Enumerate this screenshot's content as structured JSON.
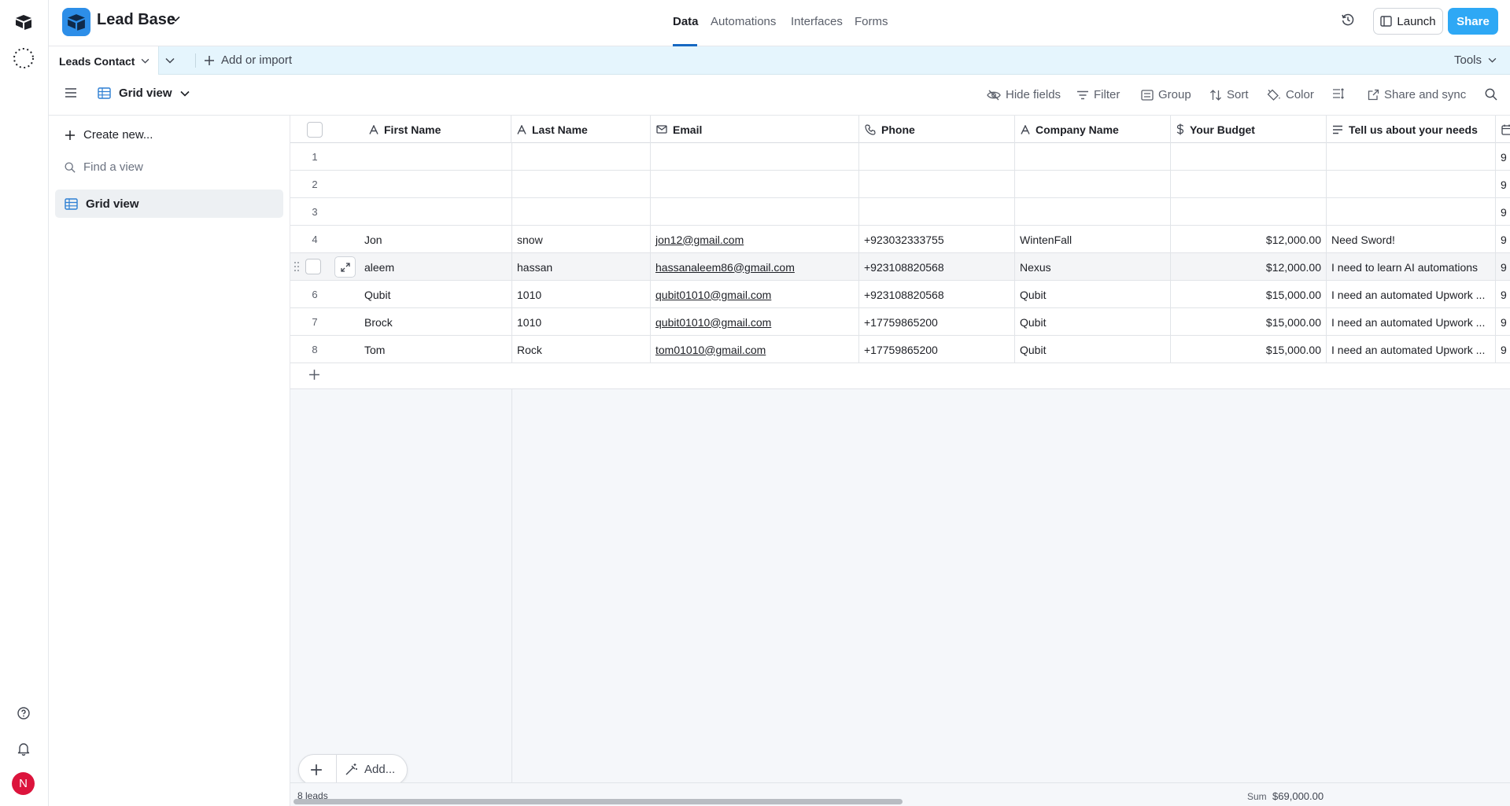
{
  "app": {
    "base_name": "Lead Base",
    "nav_tabs": [
      "Data",
      "Automations",
      "Interfaces",
      "Forms"
    ],
    "active_tab": "Data",
    "launch_label": "Launch",
    "share_label": "Share",
    "avatar_initial": "N",
    "accent_color": "#2ea8f5"
  },
  "tablebar": {
    "table_name": "Leads Contact",
    "add_import_label": "Add or import",
    "tools_label": "Tools"
  },
  "viewbar": {
    "view_name": "Grid view",
    "tools": [
      "Hide fields",
      "Filter",
      "Group",
      "Sort",
      "Color",
      "Share and sync"
    ]
  },
  "sidebar": {
    "create_new_label": "Create new...",
    "find_view_placeholder": "Find a view",
    "views": [
      "Grid view"
    ]
  },
  "grid": {
    "columns": [
      {
        "name": "First Name",
        "icon": "text-icon"
      },
      {
        "name": "Last Name",
        "icon": "text-icon"
      },
      {
        "name": "Email",
        "icon": "email-icon"
      },
      {
        "name": "Phone",
        "icon": "phone-icon"
      },
      {
        "name": "Company Name",
        "icon": "text-icon"
      },
      {
        "name": "Your Budget",
        "icon": "currency-icon"
      },
      {
        "name": "Tell us about your needs",
        "icon": "long-text-icon"
      }
    ],
    "rows": [
      {
        "num": "1",
        "first": "",
        "last": "",
        "email": "",
        "phone": "",
        "company": "",
        "budget": "",
        "needs": "",
        "extra": "9"
      },
      {
        "num": "2",
        "first": "",
        "last": "",
        "email": "",
        "phone": "",
        "company": "",
        "budget": "",
        "needs": "",
        "extra": "9"
      },
      {
        "num": "3",
        "first": "",
        "last": "",
        "email": "",
        "phone": "",
        "company": "",
        "budget": "",
        "needs": "",
        "extra": "9"
      },
      {
        "num": "4",
        "first": "Jon",
        "last": "snow",
        "email": "jon12@gmail.com",
        "phone": "+923032333755",
        "company": "WintenFall",
        "budget": "$12,000.00",
        "needs": "Need Sword!",
        "extra": "9"
      },
      {
        "num": "5",
        "first": "aleem",
        "last": "hassan",
        "email": "hassanaleem86@gmail.com",
        "phone": "+923108820568",
        "company": "Nexus",
        "budget": "$12,000.00",
        "needs": "I need to learn AI automations",
        "extra": "9"
      },
      {
        "num": "6",
        "first": "Qubit",
        "last": "1010",
        "email": "qubit01010@gmail.com",
        "phone": "+923108820568",
        "company": "Qubit",
        "budget": "$15,000.00",
        "needs": "I need an automated Upwork ...",
        "extra": "9"
      },
      {
        "num": "7",
        "first": "Brock",
        "last": "1010",
        "email": "qubit01010@gmail.com",
        "phone": "+17759865200",
        "company": "Qubit",
        "budget": "$15,000.00",
        "needs": "I need an automated Upwork ...",
        "extra": "9"
      },
      {
        "num": "8",
        "first": "Tom",
        "last": "Rock",
        "email": "tom01010@gmail.com",
        "phone": "+17759865200",
        "company": "Qubit",
        "budget": "$15,000.00",
        "needs": "I need an automated Upwork ...",
        "extra": "9"
      }
    ],
    "add_label": "Add...",
    "record_count": "8 leads",
    "sum_label": "Sum",
    "sum_value": "$69,000.00"
  }
}
